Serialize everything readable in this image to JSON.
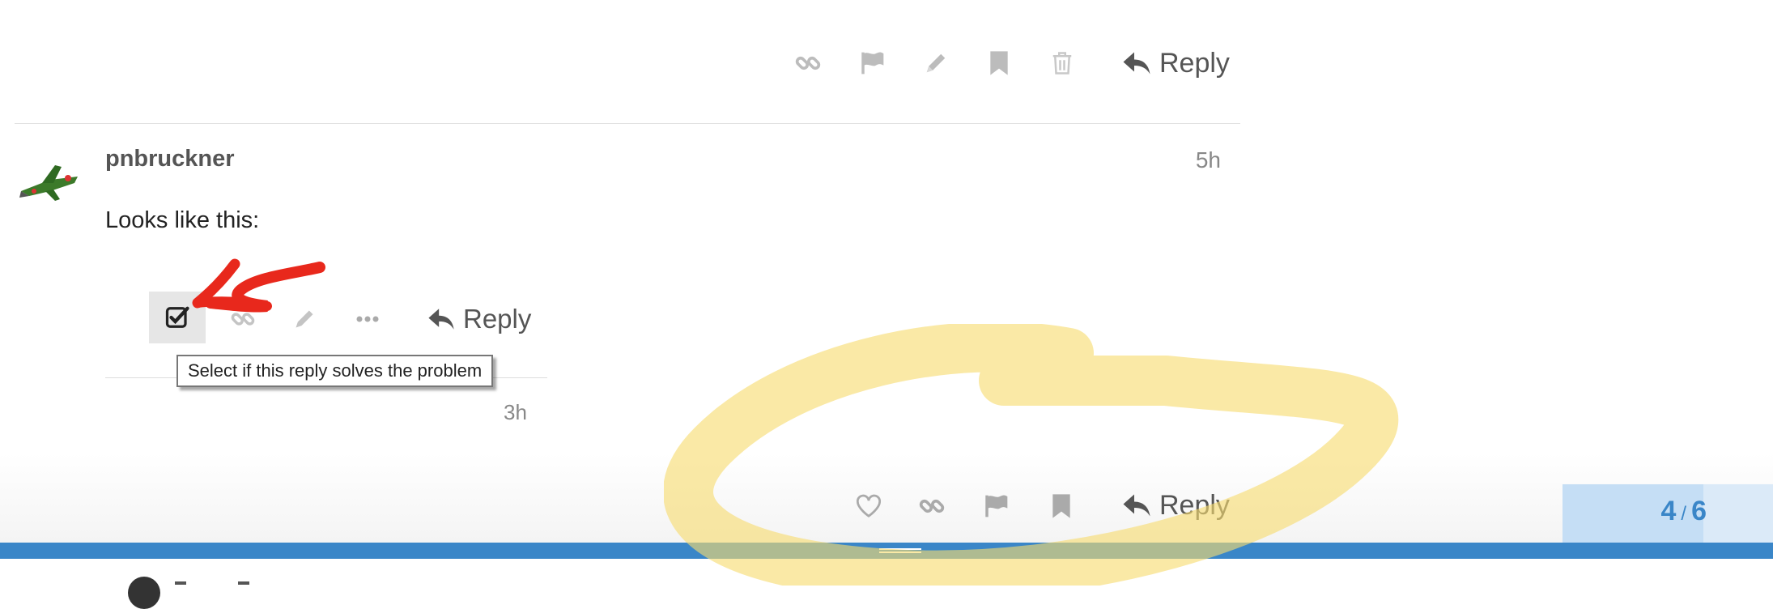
{
  "top_actions": {
    "reply_label": "Reply",
    "icons": [
      "link-icon",
      "flag-icon",
      "pencil-icon",
      "bookmark-icon",
      "trash-icon",
      "reply-arrow-icon"
    ]
  },
  "post": {
    "username": "pnbruckner",
    "time": "5h",
    "text": "Looks like this:",
    "avatar": "avatar-spaceship"
  },
  "embedded_screenshot": {
    "reply_label": "Reply",
    "tooltip": "Select if this reply solves the problem",
    "time": "3h",
    "icons": [
      "checkbox-icon",
      "link-icon",
      "pencil-icon",
      "more-icon",
      "reply-arrow-icon"
    ]
  },
  "bottom_actions": {
    "reply_label": "Reply",
    "icons": [
      "heart-icon",
      "link-icon",
      "flag-icon",
      "bookmark-icon",
      "reply-arrow-icon"
    ]
  },
  "progress": {
    "current": "4",
    "separator": "/",
    "total": "6",
    "fraction": 0.67
  },
  "colors": {
    "accent": "#3a86c8",
    "progress_bg": "#dbeaf8",
    "icon_gray": "#bcbcbc",
    "annotation_red": "#e8281c",
    "annotation_yellow": "#f7dc6f"
  }
}
